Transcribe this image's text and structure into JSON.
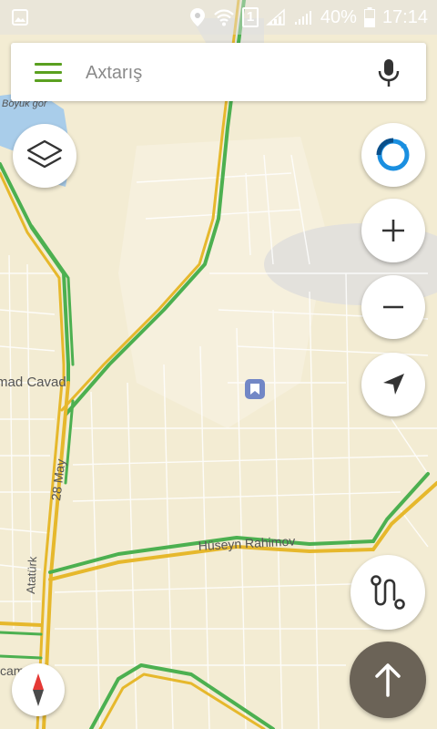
{
  "status_bar": {
    "sim_number": "1",
    "battery": "40%",
    "time": "17:14",
    "icons": [
      "image-icon",
      "location-icon",
      "wifi-icon",
      "sim-icon",
      "signal-icon",
      "battery-icon"
    ]
  },
  "search": {
    "placeholder": "Axtarış"
  },
  "map": {
    "labels": {
      "lake": "Böyük gör",
      "street_cavad": "mad Cavad",
      "street_28may": "28 May",
      "street_ataturk": "Atatürk",
      "street_huseyn": "Hüseyn Rahimov",
      "street_cam": "cam"
    },
    "marker_icon": "bookmark-icon"
  },
  "controls": {
    "layers": "layers-icon",
    "compass": "compass-icon",
    "zoom_in": "plus-icon",
    "zoom_out": "minus-icon",
    "locate": "navigation-arrow-icon",
    "route": "route-icon",
    "go": "arrow-up-icon",
    "north": "north-arrow-icon"
  },
  "colors": {
    "map_bg": "#f3ecd3",
    "road_green": "#4cb050",
    "road_yellow": "#e6b82c",
    "accent": "#5aa020",
    "compass_blue": "#1a8fe0",
    "go_button": "#6b6357"
  }
}
